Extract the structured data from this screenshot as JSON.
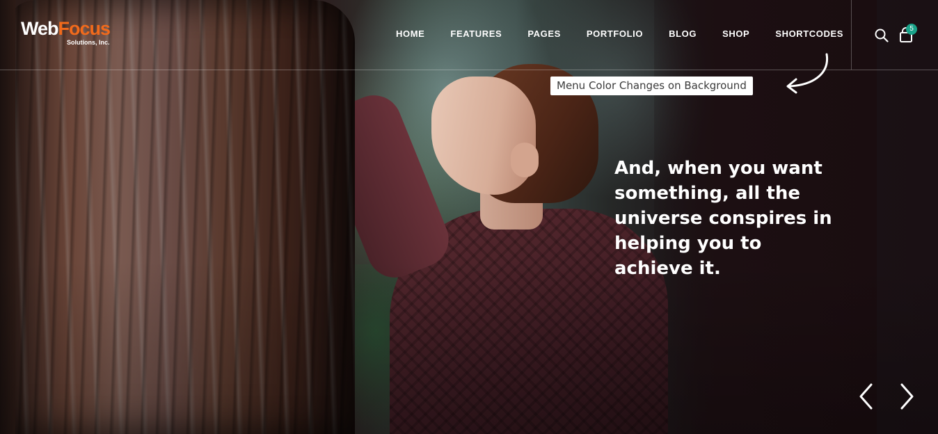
{
  "logo": {
    "brand_first": "Web",
    "brand_second": "Focus",
    "tagline": "Solutions, Inc.",
    "brand_accent_color": "#f26a1b"
  },
  "nav": {
    "items": [
      {
        "label": "HOME"
      },
      {
        "label": "FEATURES"
      },
      {
        "label": "PAGES"
      },
      {
        "label": "PORTFOLIO"
      },
      {
        "label": "BLOG"
      },
      {
        "label": "SHOP"
      },
      {
        "label": "SHORTCODES"
      }
    ]
  },
  "header_icons": {
    "search_icon": "search-icon",
    "cart_icon": "shopping-bag-icon",
    "cart_count": "5",
    "badge_color": "#1aa38a"
  },
  "annotation": {
    "text": "Menu Color Changes on Background"
  },
  "hero": {
    "quote": "And, when you want something, all the universe conspires in helping you to achieve it."
  },
  "slider": {
    "prev_icon": "chevron-left-icon",
    "next_icon": "chevron-right-icon"
  }
}
